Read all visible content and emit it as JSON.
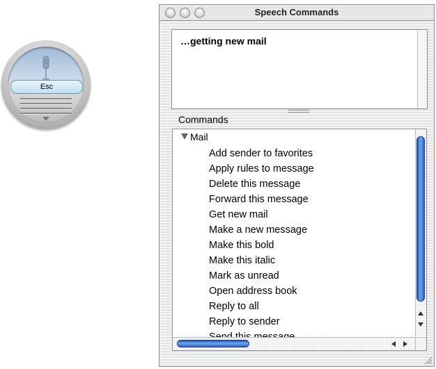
{
  "feedback": {
    "esc_label": "Esc"
  },
  "window": {
    "title": "Speech Commands",
    "status_text": "…getting new mail",
    "commands_heading": "Commands",
    "group_label": "Mail",
    "commands": [
      "Add sender to favorites",
      "Apply rules to message",
      "Delete this message",
      "Forward this message",
      "Get new mail",
      "Make a new message",
      "Make this bold",
      "Make this italic",
      "Mark as unread",
      "Open address book",
      "Reply to all",
      "Reply to sender",
      "Send this message"
    ]
  },
  "colors": {
    "scroll_thumb": "#2f62c8",
    "feedback_tint": "#bfe0f3"
  }
}
